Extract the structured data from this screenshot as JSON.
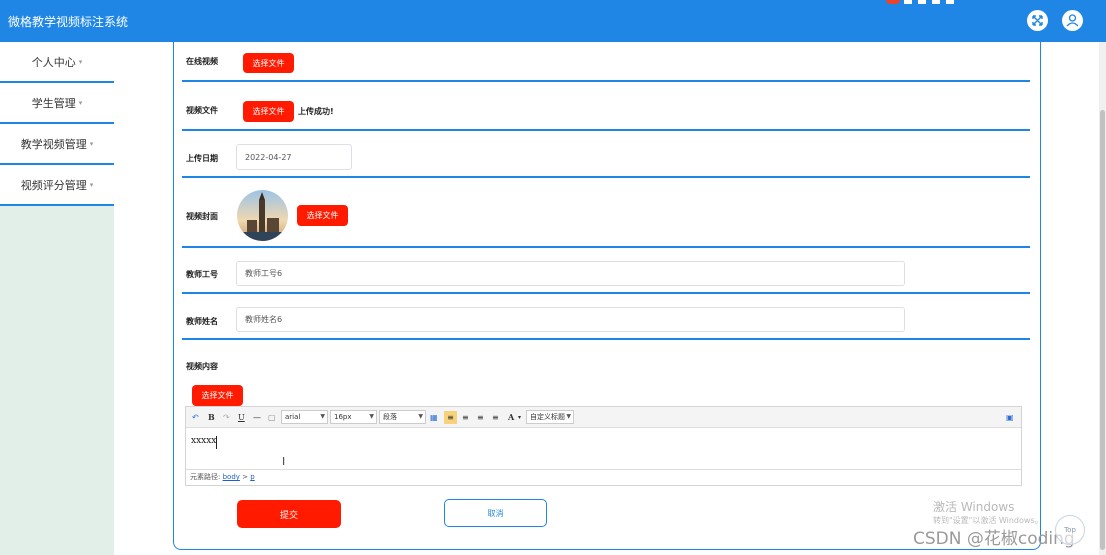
{
  "app": {
    "title": "微格教学视频标注系统"
  },
  "colors": {
    "primary": "#1f86e6",
    "danger": "#ff1a00",
    "sidebar_bg": "#e2efe8"
  },
  "header": {
    "icons": [
      "fullscreen-icon",
      "user-icon"
    ]
  },
  "sidebar": {
    "items": [
      {
        "label": "个人中心",
        "caret": "▾"
      },
      {
        "label": "学生管理",
        "caret": "▾"
      },
      {
        "label": "教学视频管理",
        "caret": "▾"
      },
      {
        "label": "视频评分管理",
        "caret": "▾"
      }
    ]
  },
  "form": {
    "online_video": {
      "label": "在线视频",
      "button": "选择文件"
    },
    "video_file": {
      "label": "视频文件",
      "button": "选择文件",
      "status": "上传成功!"
    },
    "upload_date": {
      "label": "上传日期",
      "value": "2022-04-27"
    },
    "cover": {
      "label": "视频封面",
      "button": "选择文件"
    },
    "teacher_id": {
      "label": "教师工号",
      "value": "教师工号6"
    },
    "teacher_name": {
      "label": "教师姓名",
      "value": "教师姓名6"
    },
    "content": {
      "label": "视频内容",
      "button": "选择文件",
      "toolbar": {
        "font_family": "arial",
        "font_size": "16px",
        "paragraph": "段落",
        "custom_title": "自定义标题"
      },
      "text": "xxxxx",
      "path_label": "元素路径:",
      "path_body": "body",
      "path_sep": ">",
      "path_p": "p"
    },
    "submit_label": "提交",
    "cancel_label": "取消"
  },
  "overlay": {
    "activate_title": "激活 Windows",
    "activate_sub": "转到\"设置\"以激活 Windows。",
    "csdn": "CSDN @花椒coding",
    "top_label": "Top"
  }
}
